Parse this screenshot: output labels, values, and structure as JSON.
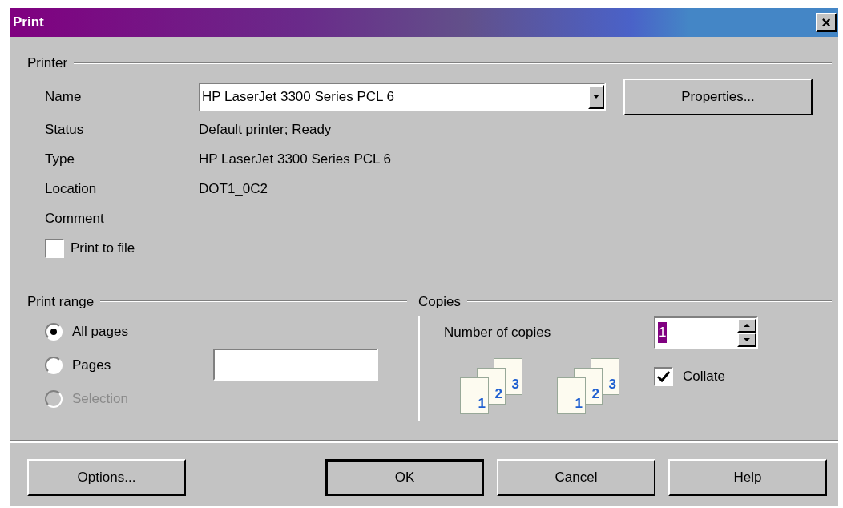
{
  "window": {
    "title": "Print",
    "close": "×"
  },
  "printer": {
    "label": "Printer",
    "name_label": "Name",
    "name_value": "HP LaserJet 3300 Series PCL 6",
    "properties": "Properties...",
    "info": [
      {
        "label": "Status",
        "value": "Default printer; Ready"
      },
      {
        "label": "Type",
        "value": "HP LaserJet 3300 Series PCL 6"
      },
      {
        "label": "Location",
        "value": "DOT1_0C2"
      },
      {
        "label": "Comment"
      }
    ],
    "print_to_file": {
      "label": "Print to file",
      "checked": false
    }
  },
  "print_range": {
    "label": "Print range",
    "options": [
      {
        "label": "All pages",
        "selected": true,
        "disabled": false
      },
      {
        "label": "Pages",
        "selected": false,
        "disabled": false
      },
      {
        "label": "Selection",
        "selected": false,
        "disabled": true
      }
    ]
  },
  "copies": {
    "label": "Copies",
    "number_label": "Number of copies",
    "number_value": "1",
    "pictures": [
      {
        "pages": [
          "1",
          "2",
          "3"
        ]
      },
      {
        "pages": [
          "1",
          "2",
          "3"
        ]
      }
    ],
    "collate": {
      "label": "Collate",
      "checked": true
    }
  },
  "buttons": [
    {
      "label": "Options...",
      "default": false
    },
    {
      "label": "OK",
      "default": true
    },
    {
      "label": "Cancel",
      "default": false
    },
    {
      "label": "Help",
      "default": false
    }
  ]
}
